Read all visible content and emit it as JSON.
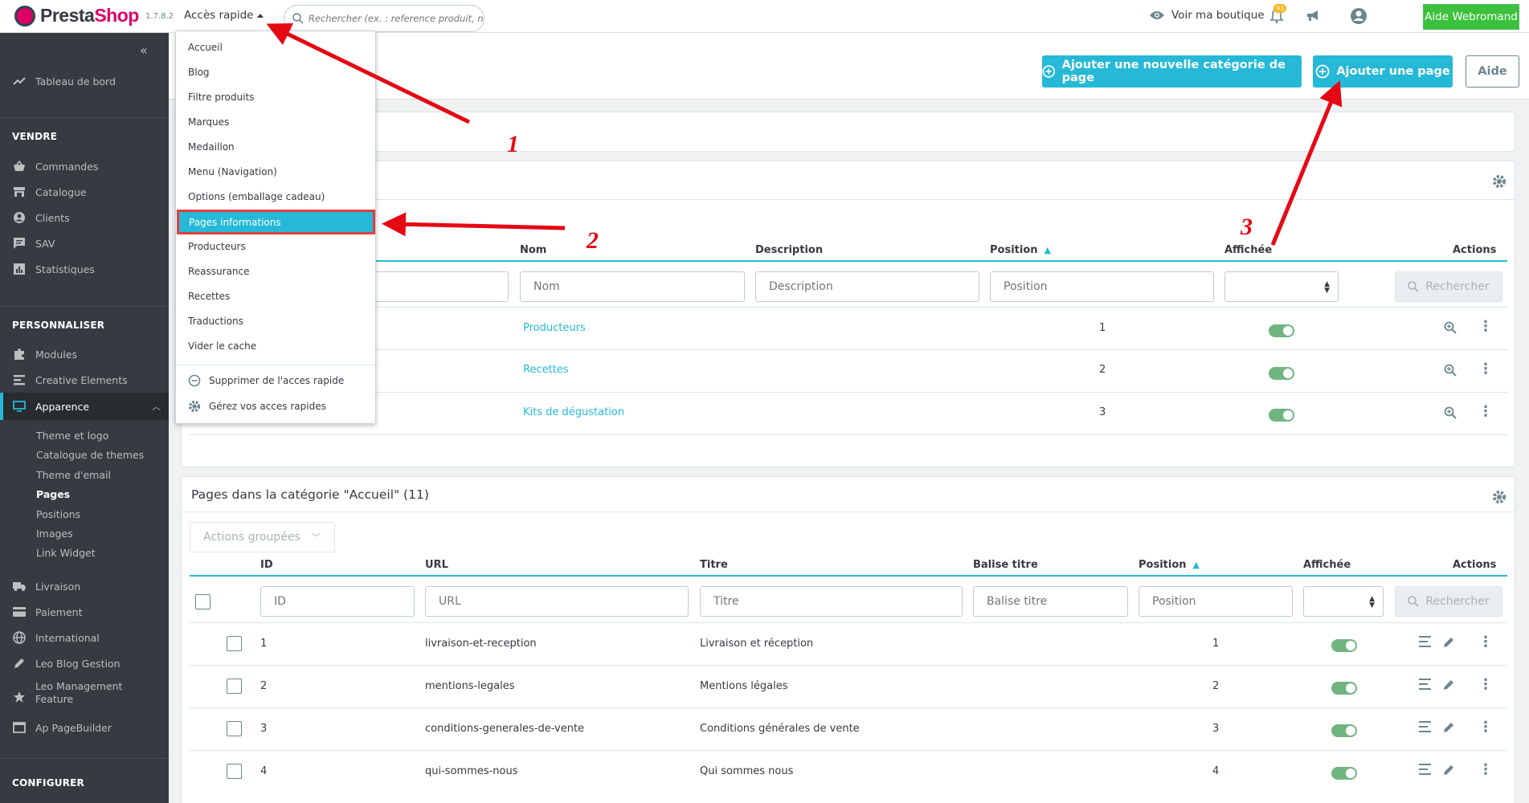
{
  "header": {
    "logo_prefix": "Presta",
    "logo_suffix": "Shop",
    "version": "1.7.8.2",
    "quick_access_label": "Accès rapide",
    "search_placeholder": "Rechercher (ex. : reference produit, no",
    "view_shop": "Voir ma boutique",
    "notifications_count": "93",
    "help_button": "Aide Webromand"
  },
  "sidebar": {
    "dashboard": "Tableau de bord",
    "sell_title": "VENDRE",
    "sell_items": [
      "Commandes",
      "Catalogue",
      "Clients",
      "SAV",
      "Statistiques"
    ],
    "customize_title": "PERSONNALISER",
    "customize_items": [
      "Modules",
      "Creative Elements",
      "Apparence"
    ],
    "appearance_sub": [
      "Theme et logo",
      "Catalogue de themes",
      "Theme d'email",
      "Pages",
      "Positions",
      "Images",
      "Link Widget"
    ],
    "more_items": [
      "Livraison",
      "Paiement",
      "International",
      "Leo Blog Gestion",
      "Leo Management",
      "Feature",
      "Ap PageBuilder"
    ],
    "configure_title": "CONFIGURER"
  },
  "quick_access_menu": {
    "items": [
      "Accueil",
      "Blog",
      "Filtre produits",
      "Marques",
      "Medaillon",
      "Menu (Navigation)",
      "Options (emballage cadeau)",
      "Pages informations",
      "Producteurs",
      "Reassurance",
      "Recettes",
      "Traductions",
      "Vider le cache"
    ],
    "remove_label": "Supprimer de l'acces rapide",
    "manage_label": "Gérez vos acces rapides"
  },
  "toolbar": {
    "add_category": "Ajouter une nouvelle catégorie de page",
    "add_page": "Ajouter une page",
    "help": "Aide"
  },
  "categories_table": {
    "headers": {
      "name": "Nom",
      "description": "Description",
      "position": "Position",
      "displayed": "Affichée",
      "actions": "Actions"
    },
    "filters": {
      "name": "Nom",
      "description": "Description",
      "position": "Position"
    },
    "search_button": "Rechercher",
    "rows": [
      {
        "name": "Producteurs",
        "position": "1",
        "displayed": true
      },
      {
        "name": "Recettes",
        "position": "2",
        "displayed": true
      },
      {
        "name": "Kits de dégustation",
        "position": "3",
        "displayed": true
      }
    ]
  },
  "pages_table": {
    "title": "Pages dans la catégorie \"Accueil\" (11)",
    "bulk_actions": "Actions groupées",
    "headers": {
      "id": "ID",
      "url": "URL",
      "title": "Titre",
      "meta_title": "Balise titre",
      "position": "Position",
      "displayed": "Affichée",
      "actions": "Actions"
    },
    "filters": {
      "id": "ID",
      "url": "URL",
      "title": "Titre",
      "meta_title": "Balise titre",
      "position": "Position"
    },
    "search_button": "Rechercher",
    "rows": [
      {
        "id": "1",
        "url": "livraison-et-reception",
        "title": "Livraison et réception",
        "position": "1",
        "displayed": true
      },
      {
        "id": "2",
        "url": "mentions-legales",
        "title": "Mentions légales",
        "position": "2",
        "displayed": true
      },
      {
        "id": "3",
        "url": "conditions-generales-de-vente",
        "title": "Conditions générales de vente",
        "position": "3",
        "displayed": true
      },
      {
        "id": "4",
        "url": "qui-sommes-nous",
        "title": "Qui sommes nous",
        "position": "4",
        "displayed": true
      }
    ]
  },
  "annotations": [
    "1",
    "2",
    "3"
  ],
  "colors": {
    "accent": "#25b9d7",
    "sidebar": "#363a41",
    "annotation": "#e50914",
    "toggle_on": "#70b580"
  }
}
